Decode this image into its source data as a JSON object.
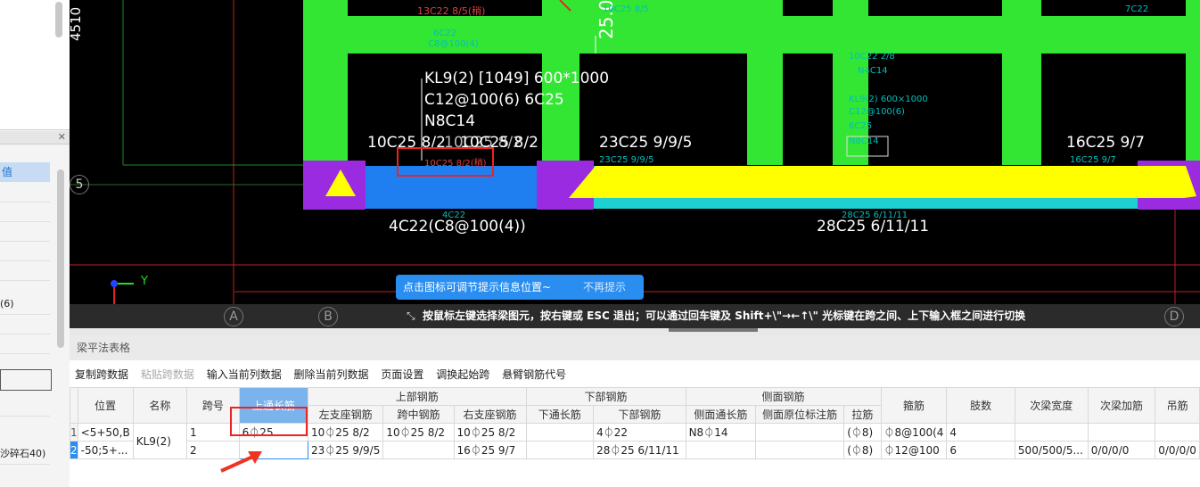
{
  "left_panel": {
    "column_header": "值",
    "rows": [
      "(6)",
      "沙碎石40)"
    ]
  },
  "cad": {
    "beam_label": {
      "line1": "KL9(2) [1049] 600*1000",
      "line2": "C12@100(6) 6C25",
      "line3": "N8C14",
      "line4": "10C25 8/2",
      "line4b": "10C25 8/2",
      "line4c": "10C25 8/2"
    },
    "span2_top": "23C25 9/9/5",
    "right_top": "16C25 9/7",
    "span1_bottom": "4C22(C8@100(4))",
    "span2_bottom": "28C25 6/11/11",
    "vertical_num": "4510",
    "large_vertical": "25.0",
    "small_labels": {
      "top_red": "13C22 8/5(稍)",
      "top_mid": "10C25 8/5",
      "right_top": "7C22",
      "sel_red": "10C25 8/2(稍)",
      "span2_small": "23C25 9/9/5",
      "right_small": "16C25 9/7",
      "kl2_top": "10C22 2/8",
      "kl2_n": "N4C14",
      "kl2_a": "KL9(2) 600×1000",
      "kl2_b": "C12@100(6)",
      "kl2_c": "6C25",
      "kl2_d": "N8C14",
      "span1_small": "4C22",
      "span2_small_b": "28C25 6/11/11",
      "c6c22": "6C22",
      "c8": "C8@100(4)"
    },
    "axis_row": "5",
    "axis_cols": [
      "A",
      "B",
      "D"
    ],
    "ucs_x": "X",
    "ucs_y": "Y"
  },
  "tip": {
    "text": "点击图标可调节提示信息位置~",
    "dismiss": "不再提示"
  },
  "status": {
    "message": "按鼠标左键选择梁图元，按右键或 ESC 退出；可以通过回车键及 Shift+\\\"→←↑\\\" 光标键在跨之间、上下输入框之间进行切换"
  },
  "panel": {
    "title": "梁平法表格",
    "toolbar": [
      "复制跨数据",
      "粘贴跨数据",
      "输入当前列数据",
      "删除当前列数据",
      "页面设置",
      "调换起始跨",
      "悬臂钢筋代号"
    ],
    "headers": {
      "position": "位置",
      "name": "名称",
      "span": "跨号",
      "top_through": "上通长筋",
      "top_group": "上部钢筋",
      "bottom_group": "下部钢筋",
      "side_group": "侧面钢筋",
      "stirrup": "箍筋",
      "legs": "肢数",
      "sec_width": "次梁宽度",
      "sec_add": "次梁加筋",
      "hanger": "吊筋",
      "left_support": "左支座钢筋",
      "mid_span": "跨中钢筋",
      "right_support": "右支座钢筋",
      "bottom_through": "下通长筋",
      "bottom_bars": "下部钢筋",
      "side_through": "侧面通长筋",
      "side_orig": "侧面原位标注筋",
      "tie": "拉筋"
    },
    "rows": [
      {
        "idx": "1",
        "position": "<5+50,B",
        "name": "KL9(2)",
        "span": "1",
        "top_through": "6⏀25",
        "left_support": "10⏀25 8/2",
        "mid_span": "10⏀25 8/2",
        "right_support": "10⏀25 8/2",
        "bottom_through": "",
        "bottom_bars": "4⏀22",
        "side_through": "N8⏀14",
        "side_orig": "",
        "tie": "(⏀8)",
        "stirrup": "⏀8@100(4",
        "legs": "4",
        "sec_width": "",
        "sec_add": "",
        "hanger": ""
      },
      {
        "idx": "2",
        "position": "-50;5+...",
        "span": "2",
        "top_through": "",
        "left_support": "23⏀25 9/9/5",
        "mid_span": "",
        "right_support": "16⏀25 9/7",
        "bottom_through": "",
        "bottom_bars": "28⏀25 6/11/11",
        "side_through": "",
        "side_orig": "",
        "tie": "(⏀8)",
        "stirrup": "⏀12@100",
        "legs": "6",
        "sec_width": "500/500/5...",
        "sec_add": "0/0/0/0",
        "hanger": "0/0/0/0"
      }
    ]
  }
}
